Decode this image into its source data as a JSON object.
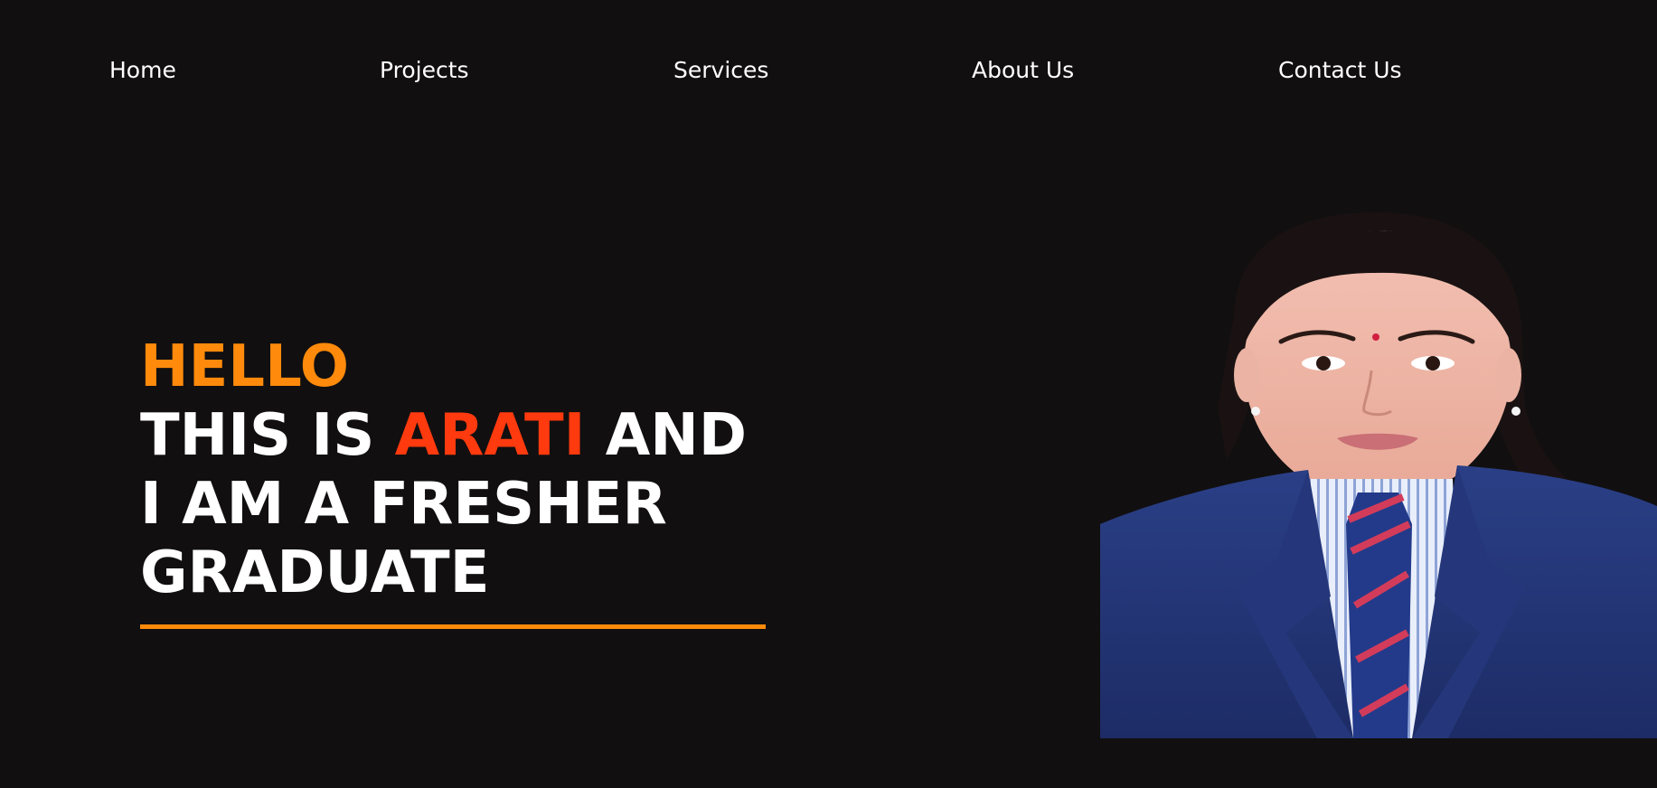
{
  "nav": {
    "items": [
      {
        "label": "Home"
      },
      {
        "label": "Projects"
      },
      {
        "label": "Services"
      },
      {
        "label": "About Us"
      },
      {
        "label": "Contact Us"
      }
    ]
  },
  "hero": {
    "greeting": "HELLO",
    "line1_prefix": "THIS IS ",
    "name": "ARATI",
    "line1_suffix": " AND",
    "line2": "I AM A FRESHER",
    "line3": "GRADUATE"
  },
  "colors": {
    "background": "#110f10",
    "accent_orange": "#ff8a0b",
    "accent_red": "#ff3a0e",
    "text": "#ffffff"
  },
  "portrait": {
    "icon": "person-photo"
  }
}
